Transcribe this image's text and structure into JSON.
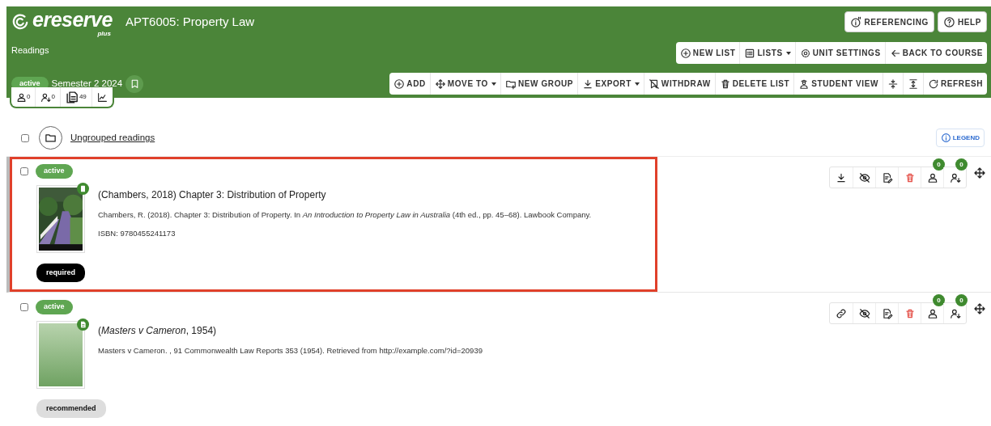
{
  "header": {
    "logo": {
      "text": "ereserve",
      "subtext": "plus"
    },
    "title": "APT6005: Property Law",
    "buttons": [
      {
        "kind": "referencing",
        "label": "REFERENCING"
      },
      {
        "kind": "help",
        "label": "HELP"
      }
    ]
  },
  "breadcrumb": "Readings",
  "list_toolbar": [
    {
      "kind": "plus",
      "label": "NEW LIST",
      "dropdown": false
    },
    {
      "kind": "list",
      "label": "LISTS",
      "dropdown": true
    },
    {
      "kind": "gear",
      "label": "UNIT SETTINGS",
      "dropdown": false
    },
    {
      "kind": "back",
      "label": "BACK TO COURSE",
      "dropdown": false
    }
  ],
  "list_status": "active",
  "semester": "Semester 2 2024",
  "stats": [
    {
      "kind": "person",
      "value": "0"
    },
    {
      "kind": "assigned",
      "value": "0"
    },
    {
      "kind": "document",
      "value": "49"
    },
    {
      "kind": "chart"
    }
  ],
  "actions_toolbar": [
    {
      "kind": "plus",
      "label": "ADD",
      "dropdown": false
    },
    {
      "kind": "move",
      "label": "MOVE TO",
      "dropdown": true
    },
    {
      "kind": "folder",
      "label": "NEW GROUP",
      "dropdown": false
    },
    {
      "kind": "download",
      "label": "EXPORT",
      "dropdown": true
    },
    {
      "kind": "withdraw",
      "label": "WITHDRAW",
      "dropdown": false
    },
    {
      "kind": "trash",
      "label": "DELETE LIST",
      "dropdown": false
    },
    {
      "kind": "student",
      "label": "STUDENT VIEW",
      "dropdown": false
    },
    {
      "kind": "collapse",
      "dropdown": false
    },
    {
      "kind": "expand",
      "dropdown": false
    },
    {
      "kind": "refresh",
      "label": "REFRESH",
      "dropdown": false
    }
  ],
  "group": {
    "title": "Ungrouped readings",
    "checked": false
  },
  "legend": "LEGEND",
  "readings": [
    {
      "kind": "book",
      "checked": false,
      "highlighted": true,
      "status": "active",
      "title": "(Chambers, 2018) Chapter 3: Distribution of Property",
      "citation": "Chambers, R. (2018). Chapter 3: Distribution of Property. In *An Introduction to Property Law in Australia* (4th ed., pp. 45–68). Lawbook Company.",
      "isbn": "ISBN: 9780455241173",
      "tag": {
        "label": "required",
        "kind": "required"
      },
      "actions": [
        {
          "kind": "download"
        },
        {
          "kind": "hide"
        },
        {
          "kind": "edit"
        },
        {
          "kind": "trash"
        },
        {
          "kind": "person",
          "count": "0"
        },
        {
          "kind": "assigned",
          "count": "0"
        }
      ]
    },
    {
      "kind": "document",
      "checked": false,
      "highlighted": false,
      "status": "active",
      "cover": {
        "kind": "placeholder"
      },
      "title": "(*Masters v Cameron*, 1954)",
      "citation": "Masters v Cameron. , 91 Commonwealth Law Reports 353 (1954). Retrieved from http://example.com/?id=20939",
      "tag": {
        "label": "recommended",
        "kind": "recommended"
      },
      "actions": [
        {
          "kind": "link"
        },
        {
          "kind": "hide"
        },
        {
          "kind": "edit"
        },
        {
          "kind": "trash"
        },
        {
          "kind": "person",
          "count": "0"
        },
        {
          "kind": "assigned",
          "count": "0"
        }
      ]
    }
  ]
}
